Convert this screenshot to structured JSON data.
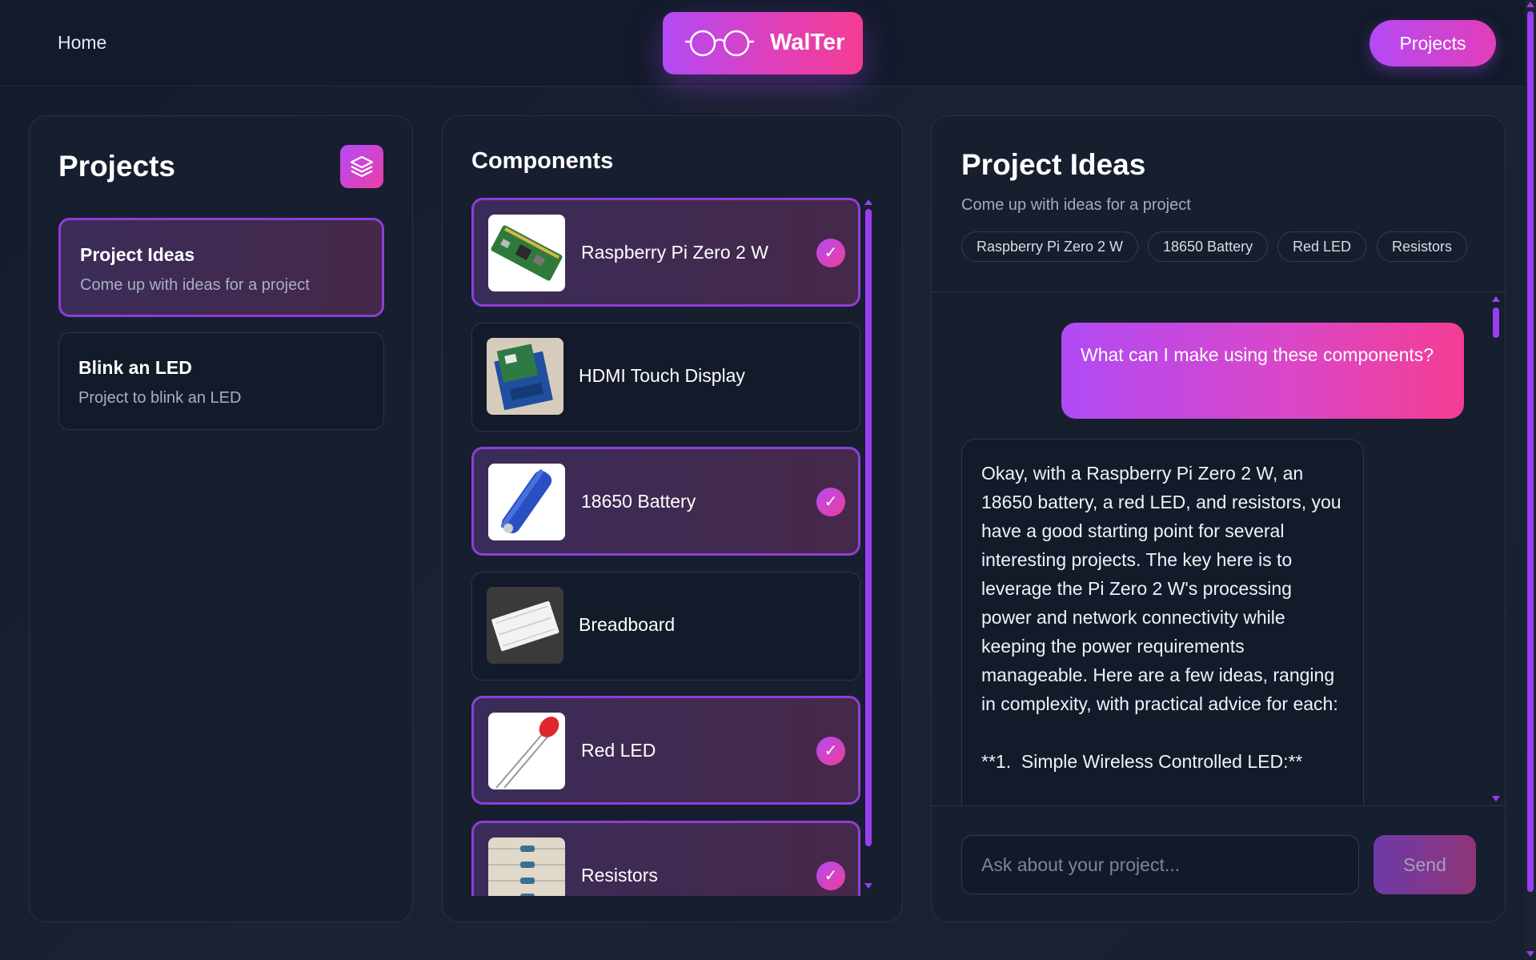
{
  "header": {
    "home_label": "Home",
    "brand_name": "WalTer",
    "projects_button": "Projects"
  },
  "projects_panel": {
    "title": "Projects",
    "projects": [
      {
        "title": "Project Ideas",
        "description": "Come up with ideas for a project",
        "active": true
      },
      {
        "title": "Blink an LED",
        "description": "Project to blink an LED",
        "active": false
      }
    ]
  },
  "components_panel": {
    "title": "Components",
    "items": [
      {
        "name": "Raspberry Pi Zero 2 W",
        "selected": true,
        "icon": "raspberry-pi-board-photo"
      },
      {
        "name": "HDMI Touch Display",
        "selected": false,
        "icon": "touch-display-photo"
      },
      {
        "name": "18650 Battery",
        "selected": true,
        "icon": "battery-photo"
      },
      {
        "name": "Breadboard",
        "selected": false,
        "icon": "breadboard-photo"
      },
      {
        "name": "Red LED",
        "selected": true,
        "icon": "red-led-photo"
      },
      {
        "name": "Resistors",
        "selected": true,
        "icon": "resistors-photo"
      }
    ],
    "check_glyph": "✓"
  },
  "chat_panel": {
    "title": "Project Ideas",
    "subtitle": "Come up with ideas for a project",
    "chips": [
      "Raspberry Pi Zero 2 W",
      "18650 Battery",
      "Red LED",
      "Resistors"
    ],
    "messages": [
      {
        "role": "user",
        "text": "What can I make using these components?"
      },
      {
        "role": "assistant",
        "text": "Okay, with a Raspberry Pi Zero 2 W, an 18650 battery, a red LED, and resistors, you have a good starting point for several interesting projects. The key here is to leverage the Pi Zero 2 W's processing power and network connectivity while keeping the power requirements manageable. Here are a few ideas, ranging in complexity, with practical advice for each:\n\n**1.  Simple Wireless Controlled LED:**"
      }
    ],
    "input_placeholder": "Ask about your project...",
    "send_label": "Send"
  },
  "colors": {
    "accent_purple": "#b44af4",
    "accent_pink": "#f43d94",
    "background": "#141b2c",
    "card_border_selected": "#8d3ed8"
  }
}
